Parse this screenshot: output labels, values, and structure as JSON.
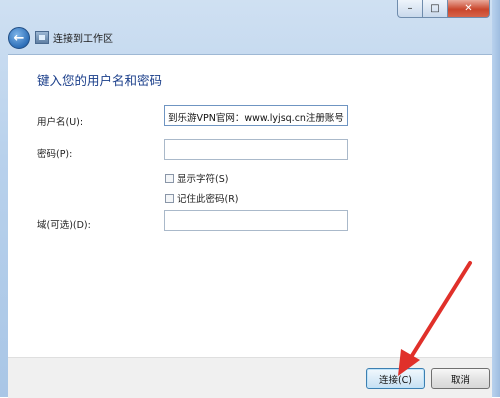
{
  "window": {
    "title": "连接到工作区",
    "controls": {
      "minimize": "–",
      "maximize": "□",
      "close": "✕"
    }
  },
  "nav": {
    "back_icon": "back-arrow-icon",
    "app_icon": "network-icon"
  },
  "form": {
    "heading": "键入您的用户名和密码",
    "username_label": "用户名(U):",
    "username_value": "到乐游VPN官网：www.lyjsq.cn注册账号",
    "password_label": "密码(P):",
    "password_value": "",
    "show_chars_label": "显示字符(S)",
    "remember_label": "记住此密码(R)",
    "domain_label": "域(可选)(D):",
    "domain_value": ""
  },
  "footer": {
    "connect_label": "连接(C)",
    "cancel_label": "取消"
  },
  "colors": {
    "arrow": "#e0302a",
    "heading": "#1a3e8a"
  }
}
